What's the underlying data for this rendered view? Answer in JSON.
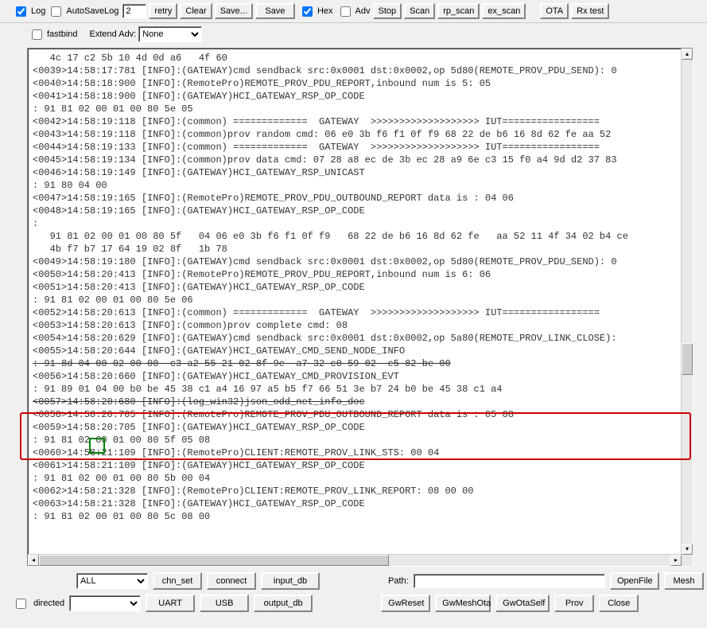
{
  "top": {
    "log_label": "Log",
    "autosave_label": "AutoSaveLog",
    "retry_value": "2",
    "retry_label": "retry",
    "clear_label": "Clear",
    "save_dots": "Save...",
    "save": "Save",
    "hex_label": "Hex",
    "adv_label": "Adv",
    "stop": "Stop",
    "scan": "Scan",
    "rp_scan": "rp_scan",
    "ex_scan": "ex_scan",
    "ota": "OTA",
    "rx_test": "Rx test",
    "fastbind_label": "fastbind",
    "extend_adv_label": "Extend Adv:",
    "extend_adv_value": "None"
  },
  "log_lines": [
    "   4c 17 c2 5b 10 4d 0d a6   4f 60",
    "<0039>14:58:17:781 [INFO]:(GATEWAY)cmd sendback src:0x0001 dst:0x0002,op 5d80(REMOTE_PROV_PDU_SEND): 0",
    "<0040>14:58:18:900 [INFO]:(RemotePro)REMOTE_PROV_PDU_REPORT,inbound num is 5: 05",
    "<0041>14:58:18:900 [INFO]:(GATEWAY)HCI_GATEWAY_RSP_OP_CODE",
    ": 91 81 02 00 01 00 80 5e 05",
    "<0042>14:58:19:118 [INFO]:(common) =============  GATEWAY  >>>>>>>>>>>>>>>>>>> IUT=================",
    "<0043>14:58:19:118 [INFO]:(common)prov random cmd: 06 e0 3b f6 f1 0f f9 68 22 de b6 16 8d 62 fe aa 52",
    "<0044>14:58:19:133 [INFO]:(common) =============  GATEWAY  >>>>>>>>>>>>>>>>>>> IUT=================",
    "<0045>14:58:19:134 [INFO]:(common)prov data cmd: 07 28 a8 ec de 3b ec 28 a9 6e c3 15 f0 a4 9d d2 37 83",
    "<0046>14:58:19:149 [INFO]:(GATEWAY)HCI_GATEWAY_RSP_UNICAST",
    ": 91 80 04 00",
    "<0047>14:58:19:165 [INFO]:(RemotePro)REMOTE_PROV_PDU_OUTBOUND_REPORT data is : 04 06",
    "<0048>14:58:19:165 [INFO]:(GATEWAY)HCI_GATEWAY_RSP_OP_CODE",
    ":",
    "   91 81 02 00 01 00 80 5f   04 06 e0 3b f6 f1 0f f9   68 22 de b6 16 8d 62 fe   aa 52 11 4f 34 02 b4 ce ",
    "   4b f7 b7 17 64 19 02 8f   1b 78",
    "<0049>14:58:19:180 [INFO]:(GATEWAY)cmd sendback src:0x0001 dst:0x0002,op 5d80(REMOTE_PROV_PDU_SEND): 0",
    "<0050>14:58:20:413 [INFO]:(RemotePro)REMOTE_PROV_PDU_REPORT,inbound num is 6: 06",
    "<0051>14:58:20:413 [INFO]:(GATEWAY)HCI_GATEWAY_RSP_OP_CODE",
    ": 91 81 02 00 01 00 80 5e 06",
    "<0052>14:58:20:613 [INFO]:(common) =============  GATEWAY  >>>>>>>>>>>>>>>>>>> IUT=================",
    "<0053>14:58:20:613 [INFO]:(common)prov complete cmd: 08",
    "<0054>14:58:20:629 [INFO]:(GATEWAY)cmd sendback src:0x0001 dst:0x0002,op 5a80(REMOTE_PROV_LINK_CLOSE):",
    "<0055>14:58:20:644 [INFO]:(GATEWAY)HCI_GATEWAY_CMD_SEND_NODE_INFO"
  ],
  "strike_line": ": 91 8d 04 00 02 00 00  c3 a2 55 21 02 8f 9e  a7 32 c0 59 02  e5 82 be 00",
  "mid_lines": [
    "<0056>14:58:20:660 [INFO]:(GATEWAY)HCI_GATEWAY_CMD_PROVISION_EVT",
    ": 91 89 01 04 00 b0 be 45 38 c1 a4 16 97 a5 b5 f7 66 51 3e b7 24 b0 be 45 38 c1 a4"
  ],
  "strike_line2": "<0057>14:58:20:680 [INFO]:(log_win32)json_odd_net_info_doc",
  "post_lines": [
    "<0058>14:58:20:705 [INFO]:(RemotePro)REMOTE_PROV_PDU_OUTBOUND_REPORT data is : 05 08",
    "<0059>14:58:20:705 [INFO]:(GATEWAY)HCI_GATEWAY_RSP_OP_CODE",
    ": 91 81 02 00 01 00 80 5f 05 08",
    "<0060>14:58:21:109 [INFO]:(RemotePro)CLIENT:REMOTE_PROV_LINK_STS: 00 04",
    "<0061>14:58:21:109 [INFO]:(GATEWAY)HCI_GATEWAY_RSP_OP_CODE",
    ": 91 81 02 00 01 00 80 5b 00 04",
    "<0062>14:58:21:328 [INFO]:(RemotePro)CLIENT:REMOTE_PROV_LINK_REPORT: 08 00 00",
    "<0063>14:58:21:328 [INFO]:(GATEWAY)HCI_GATEWAY_RSP_OP_CODE",
    ": 91 81 02 00 01 00 80 5c 08 00",
    " "
  ],
  "bottom": {
    "all_value": "ALL",
    "chn_set": "chn_set",
    "connect": "connect",
    "input_db": "input_db",
    "path_label": "Path:",
    "openfile": "OpenFile",
    "mesh": "Mesh",
    "directed_label": "directed",
    "uart": "UART",
    "usb": "USB",
    "output_db": "output_db",
    "gwreset": "GwReset",
    "gwmeshota": "GwMeshOta",
    "gwotaself": "GwOtaSelf",
    "prov": "Prov",
    "close": "Close"
  }
}
